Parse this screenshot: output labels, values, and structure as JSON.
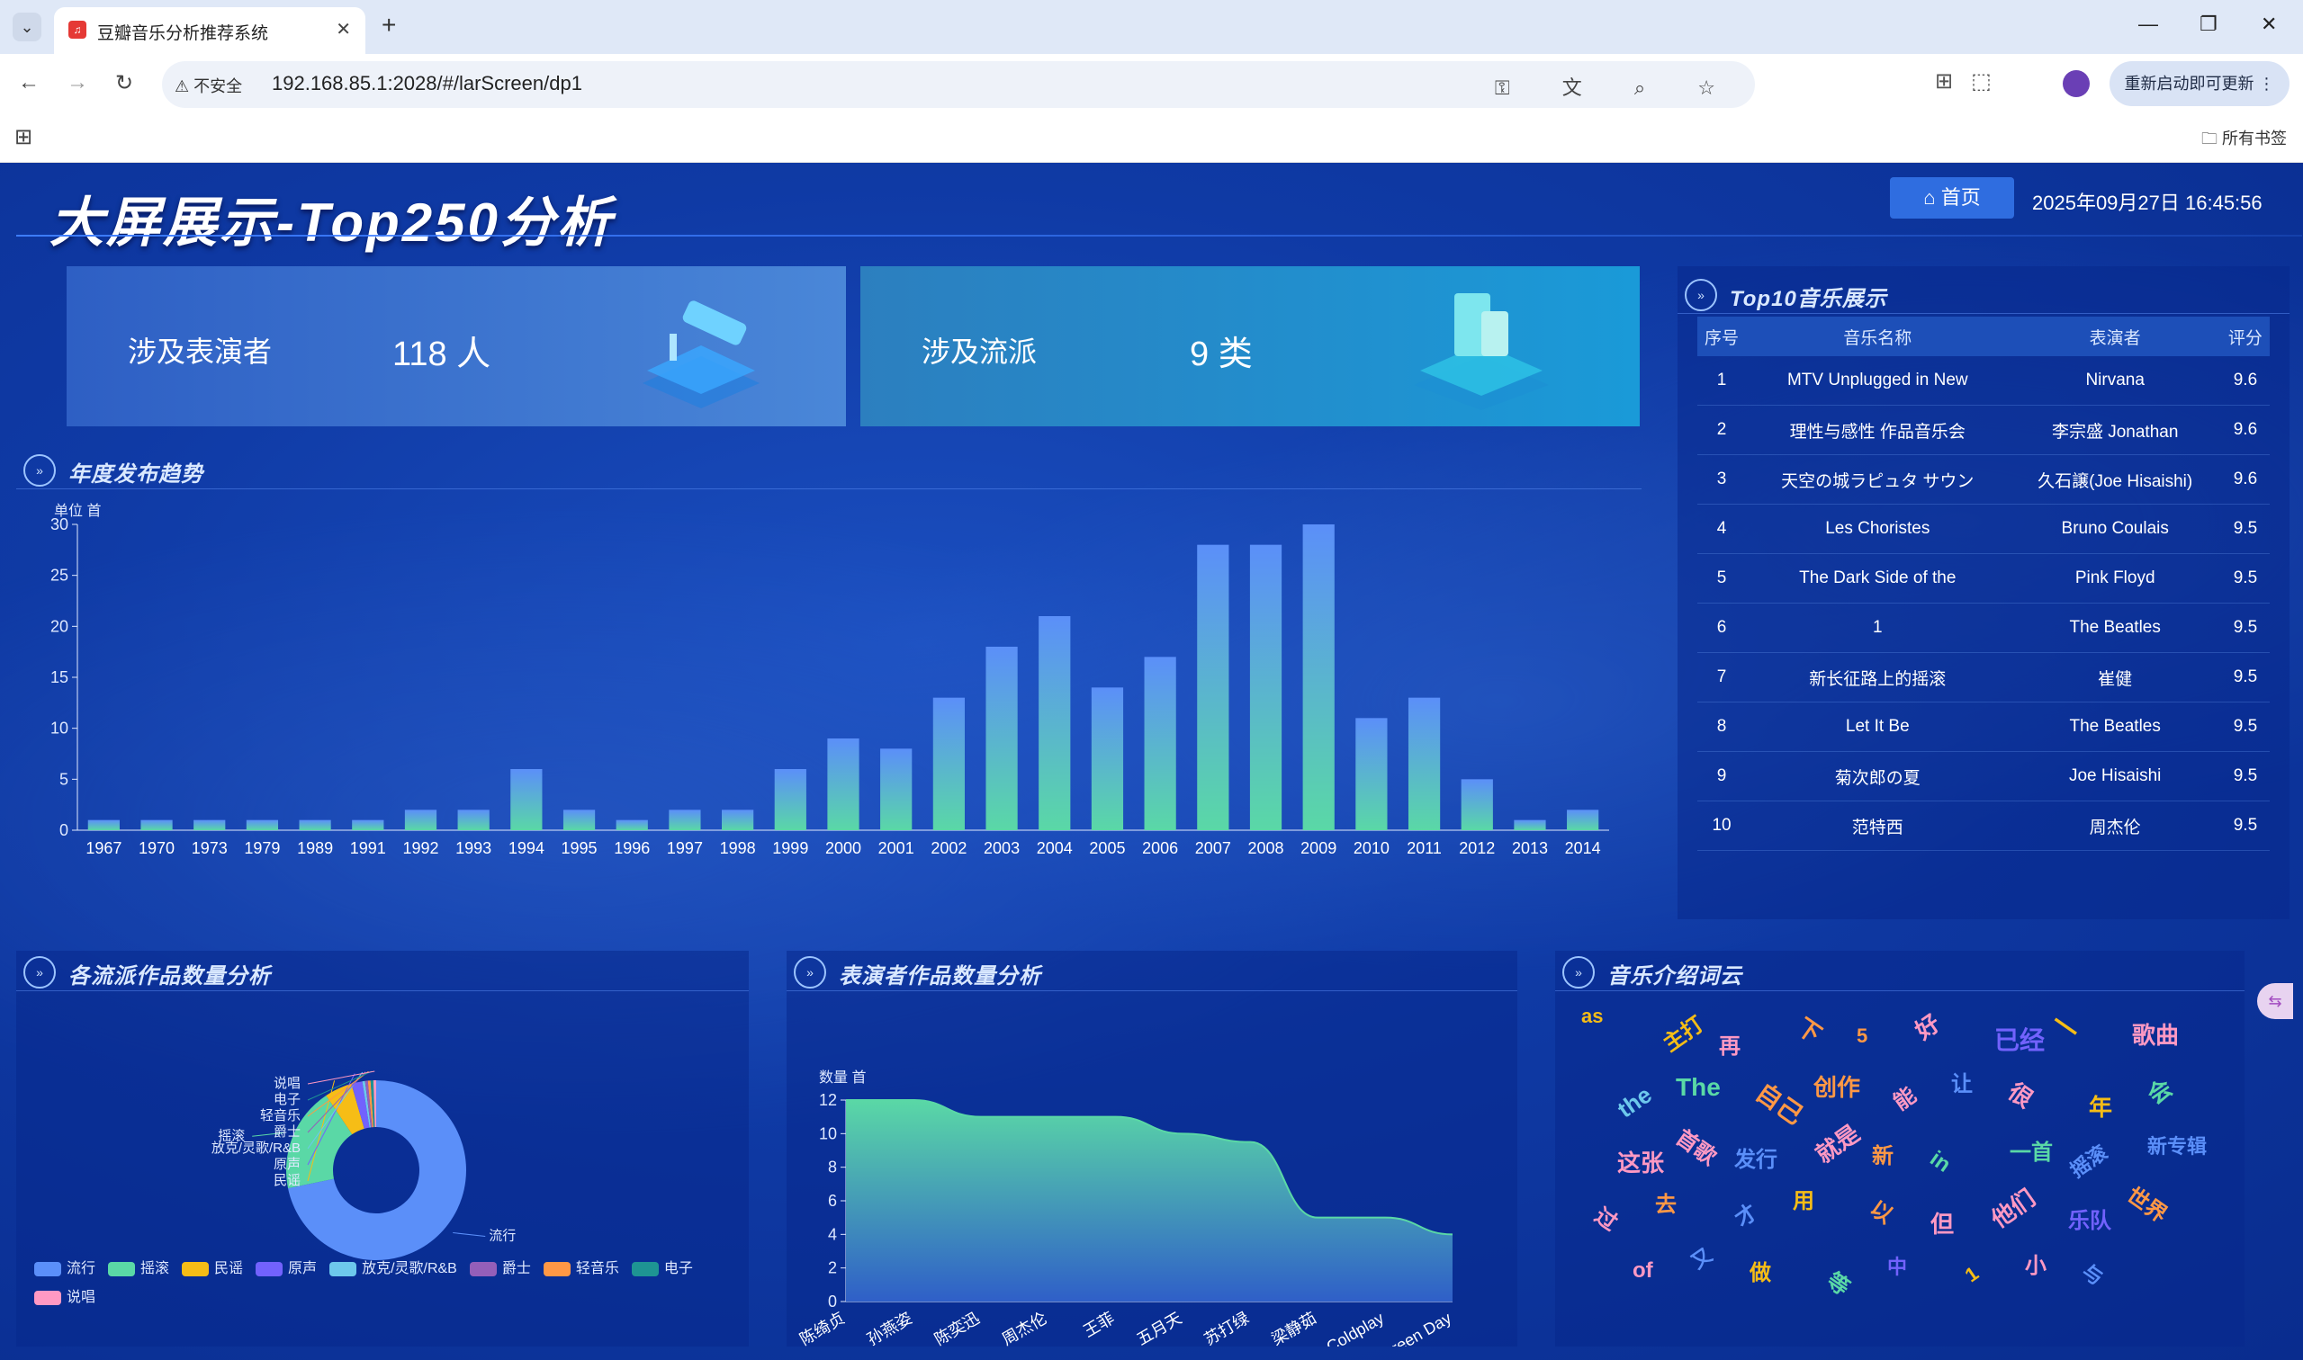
{
  "browser": {
    "tab_title": "豆瓣音乐分析推荐系统",
    "security_label": "不安全",
    "url": "192.168.85.1:2028/#/larScreen/dp1",
    "update_button": "重新启动即可更新",
    "bookmarks_label": "所有书签"
  },
  "header": {
    "title": "大屏展示-Top250分析",
    "home_button": "首页",
    "datetime": "2025年09月27日 16:45:56"
  },
  "stats": [
    {
      "label": "涉及表演者",
      "value": "118 人"
    },
    {
      "label": "涉及流派",
      "value": "9 类"
    }
  ],
  "panels": {
    "yearly": "年度发布趋势",
    "top10": "Top10音乐展示",
    "genre": "各流派作品数量分析",
    "performer": "表演者作品数量分析",
    "cloud": "音乐介绍词云"
  },
  "top10": {
    "headers": [
      "序号",
      "音乐名称",
      "表演者",
      "评分"
    ],
    "rows": [
      [
        "1",
        "MTV Unplugged in New",
        "Nirvana",
        "9.6"
      ],
      [
        "2",
        "理性与感性 作品音乐会",
        "李宗盛 Jonathan",
        "9.6"
      ],
      [
        "3",
        "天空の城ラピュタ サウン",
        "久石譲(Joe Hisaishi)",
        "9.6"
      ],
      [
        "4",
        "Les Choristes",
        "Bruno Coulais",
        "9.5"
      ],
      [
        "5",
        "The Dark Side of the",
        "Pink Floyd",
        "9.5"
      ],
      [
        "6",
        "1",
        "The Beatles",
        "9.5"
      ],
      [
        "7",
        "新长征路上的摇滚",
        "崔健",
        "9.5"
      ],
      [
        "8",
        "Let It Be",
        "The Beatles",
        "9.5"
      ],
      [
        "9",
        "菊次郎の夏",
        "Joe Hisaishi",
        "9.5"
      ],
      [
        "10",
        "范特西",
        "周杰伦",
        "9.5"
      ]
    ]
  },
  "chart_data": [
    {
      "type": "bar",
      "ylabel": "单位 首",
      "ylim": [
        0,
        30
      ],
      "yticks": [
        0,
        5,
        10,
        15,
        20,
        25,
        30
      ],
      "categories": [
        "1967",
        "1970",
        "1973",
        "1979",
        "1989",
        "1991",
        "1992",
        "1993",
        "1994",
        "1995",
        "1996",
        "1997",
        "1998",
        "1999",
        "2000",
        "2001",
        "2002",
        "2003",
        "2004",
        "2005",
        "2006",
        "2007",
        "2008",
        "2009",
        "2010",
        "2011",
        "2012",
        "2013",
        "2014"
      ],
      "values": [
        1,
        1,
        1,
        1,
        1,
        1,
        2,
        2,
        6,
        2,
        1,
        2,
        2,
        6,
        9,
        8,
        13,
        18,
        21,
        14,
        17,
        28,
        28,
        30,
        11,
        13,
        5,
        1,
        2
      ]
    },
    {
      "type": "pie",
      "donut": true,
      "slices": [
        {
          "name": "流行",
          "value": 145,
          "color": "#5b8ff9"
        },
        {
          "name": "摇滚",
          "value": 38,
          "color": "#5ad8a6"
        },
        {
          "name": "民谣",
          "value": 10,
          "color": "#f6bd16"
        },
        {
          "name": "原声",
          "value": 4,
          "color": "#7262fd"
        },
        {
          "name": "放克/灵歌/R&B",
          "value": 1,
          "color": "#6dc8ec"
        },
        {
          "name": "爵士",
          "value": 1,
          "color": "#945fb9"
        },
        {
          "name": "轻音乐",
          "value": 1,
          "color": "#ff9845"
        },
        {
          "name": "电子",
          "value": 1,
          "color": "#1e9493"
        },
        {
          "name": "说唱",
          "value": 1,
          "color": "#ff99c3"
        }
      ],
      "grid": false,
      "legend": "bottom"
    },
    {
      "type": "area",
      "ylabel": "数量 首",
      "ylim": [
        0,
        12
      ],
      "yticks": [
        0,
        2,
        4,
        6,
        8,
        10,
        12
      ],
      "categories": [
        "陈绮贞",
        "孙燕姿",
        "陈奕迅",
        "周杰伦",
        "王菲",
        "五月天",
        "苏打绿",
        "梁静茹",
        "Coldplay",
        "Green Day"
      ],
      "values": [
        12,
        12,
        11,
        11,
        11,
        10,
        9.5,
        5,
        5,
        4
      ]
    }
  ],
  "wordcloud": [
    {
      "text": "as",
      "color": "#f6bd16",
      "size": 22
    },
    {
      "text": "主打",
      "color": "#f6bd16",
      "size": 24
    },
    {
      "text": "再",
      "color": "#ff99c3",
      "size": 24
    },
    {
      "text": "下",
      "color": "#ff9845",
      "size": 26
    },
    {
      "text": "5",
      "color": "#ff9845",
      "size": 22
    },
    {
      "text": "好",
      "color": "#ff99c3",
      "size": 26
    },
    {
      "text": "已经",
      "color": "#7262fd",
      "size": 28
    },
    {
      "text": "一",
      "color": "#f6bd16",
      "size": 30
    },
    {
      "text": "歌曲",
      "color": "#ff99c3",
      "size": 26
    },
    {
      "text": "the",
      "color": "#6dc8ec",
      "size": 26
    },
    {
      "text": "The",
      "color": "#5ad8a6",
      "size": 28
    },
    {
      "text": "自己",
      "color": "#ff9845",
      "size": 28
    },
    {
      "text": "创作",
      "color": "#ff9845",
      "size": 26
    },
    {
      "text": "能",
      "color": "#ff99c3",
      "size": 24
    },
    {
      "text": "让",
      "color": "#5b8ff9",
      "size": 24
    },
    {
      "text": "很",
      "color": "#ff99c3",
      "size": 26
    },
    {
      "text": "年",
      "color": "#f6bd16",
      "size": 26
    },
    {
      "text": "会",
      "color": "#5ad8a6",
      "size": 26
    },
    {
      "text": "这张",
      "color": "#ff99c3",
      "size": 26
    },
    {
      "text": "首歌",
      "color": "#ff99c3",
      "size": 24
    },
    {
      "text": "发行",
      "color": "#5b8ff9",
      "size": 24
    },
    {
      "text": "就是",
      "color": "#ff99c3",
      "size": 26
    },
    {
      "text": "新",
      "color": "#ff9845",
      "size": 24
    },
    {
      "text": "in",
      "color": "#5ad8a6",
      "size": 24
    },
    {
      "text": "一首",
      "color": "#5ad8a6",
      "size": 24
    },
    {
      "text": "摇滚",
      "color": "#5b8ff9",
      "size": 22
    },
    {
      "text": "新专辑",
      "color": "#5b8ff9",
      "size": 22
    },
    {
      "text": "过",
      "color": "#ff99c3",
      "size": 24
    },
    {
      "text": "去",
      "color": "#ff9845",
      "size": 24
    },
    {
      "text": "才",
      "color": "#5b8ff9",
      "size": 24
    },
    {
      "text": "用",
      "color": "#f6bd16",
      "size": 24
    },
    {
      "text": "以",
      "color": "#ff9845",
      "size": 24
    },
    {
      "text": "但",
      "color": "#ff99c3",
      "size": 26
    },
    {
      "text": "他们",
      "color": "#ff99c3",
      "size": 26
    },
    {
      "text": "乐队",
      "color": "#7262fd",
      "size": 24
    },
    {
      "text": "世界",
      "color": "#ff9845",
      "size": 24
    },
    {
      "text": "of",
      "color": "#ff99c3",
      "size": 24
    },
    {
      "text": "又",
      "color": "#5b8ff9",
      "size": 22
    },
    {
      "text": "做",
      "color": "#f6bd16",
      "size": 24
    },
    {
      "text": "等",
      "color": "#5ad8a6",
      "size": 24
    },
    {
      "text": "中",
      "color": "#7262fd",
      "size": 22
    },
    {
      "text": "1",
      "color": "#f6bd16",
      "size": 22
    },
    {
      "text": "小",
      "color": "#ff99c3",
      "size": 24
    },
    {
      "text": "与",
      "color": "#5b8ff9",
      "size": 22
    }
  ]
}
